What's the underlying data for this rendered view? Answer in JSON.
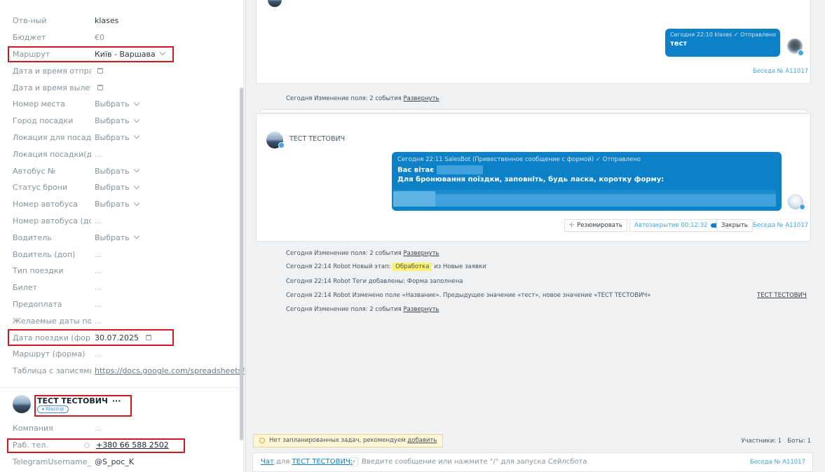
{
  "fields": [
    {
      "label": "Отв-ный",
      "value": "klases",
      "kind": "text"
    },
    {
      "label": "Бюджет",
      "value": "€0",
      "kind": "muted"
    },
    {
      "label": "Маршрут",
      "value": "Київ - Варшава",
      "kind": "select"
    },
    {
      "label": "Дата и время отправл",
      "value": "",
      "kind": "date"
    },
    {
      "label": "Дата и время вылета",
      "value": "",
      "kind": "date"
    },
    {
      "label": "Номер места",
      "value": "Выбрать",
      "kind": "select-muted"
    },
    {
      "label": "Город посадки",
      "value": "Выбрать",
      "kind": "select-muted"
    },
    {
      "label": "Локация для посадки",
      "value": "Выбрать",
      "kind": "select-muted"
    },
    {
      "label": "Локация посадки(доп)",
      "value": "...",
      "kind": "dots"
    },
    {
      "label": "Автобус №",
      "value": "Выбрать",
      "kind": "select-muted"
    },
    {
      "label": "Статус брони",
      "value": "Выбрать",
      "kind": "select-muted"
    },
    {
      "label": "Номер автобуса",
      "value": "Выбрать",
      "kind": "select-muted"
    },
    {
      "label": "Номер автобуса (доп)",
      "value": "...",
      "kind": "dots"
    },
    {
      "label": "Водитель",
      "value": "Выбрать",
      "kind": "select-muted"
    },
    {
      "label": "Водитель (доп)",
      "value": "...",
      "kind": "dots"
    },
    {
      "label": "Тип поездки",
      "value": "...",
      "kind": "dots"
    },
    {
      "label": "Билет",
      "value": "...",
      "kind": "dots"
    },
    {
      "label": "Предоплата",
      "value": "...",
      "kind": "dots"
    },
    {
      "label": "Желаемые даты поезд",
      "value": "...",
      "kind": "dots"
    },
    {
      "label": "Дата поездки (форма)",
      "value": "30.07.2025",
      "kind": "date-filled"
    },
    {
      "label": "Маршрут (форма)",
      "value": "...",
      "kind": "dots"
    },
    {
      "label": "Таблица с записями",
      "value": "https://docs.google.com/spreadsheets/c",
      "kind": "link"
    }
  ],
  "contact": {
    "name": "ТЕСТ ТЕСТОВИЧ",
    "more": "···",
    "source_tag": "◂ Wazzup",
    "company_label": "Компания",
    "company_value": "...",
    "phone_label": "Раб. тел.",
    "phone_value": "+380 66 588 2502",
    "tg_label": "TelegramUsername_W",
    "tg_value": "@S_poc_K"
  },
  "chat": {
    "msg1_meta": "Сегодня 22:10 klases ✓ Отправлено",
    "msg1_text": "тест",
    "convo_label": "Беседа № A11017",
    "event1_prefix": "Сегодня Изменение поля: 2 события",
    "expand_label": "Развернуть",
    "sender_name": "ТЕСТ ТЕСТОВИЧ",
    "msg2_meta": "Сегодня 22:11 SalesBot (Привественное сообщение с формой) ✓ Отправлено",
    "msg2_line1": "Вас вітає",
    "msg2_line2": "Для бронювання поїздки, заповніть, будь ласка, коротку форму:",
    "summarize_label": "Резюмировать",
    "autoclose_label": "Автозакрытие 00:12:32",
    "close_label": "Закрыть",
    "ev_change": "Сегодня Изменение поля: 2 события",
    "ev_stage_prefix": "Сегодня 22:14 Robot Новый этап:",
    "ev_stage_name": "Обработка",
    "ev_stage_suffix": "из Новые заявки",
    "ev_tags": "Сегодня 22:14 Robot Теги добавлены: Форма заполнена",
    "ev_rename": "Сегодня 22:14 Robot Изменено поле «Название». Предыдущее значение «тест», новое значение «ТЕСТ ТЕСТОВИЧ»",
    "ev_rename_link": "ТЕСТ ТЕСТОВИЧ",
    "ev_change2": "Сегодня Изменение поля: 2 события"
  },
  "footer": {
    "task_text": "Нет запланированных задач, рекомендуем",
    "task_link": "добавить",
    "participants": "Участники: 1   Боты: 1",
    "chat_label": "Чат",
    "for_label": "для",
    "recipient": "ТЕСТ ТЕСТОВИЧ:",
    "input_placeholder": "Введите сообщение или нажмите \"/\" для запуска Сейлсбота",
    "convo_label": "Беседа № A11017"
  },
  "colors": {
    "accent": "#0c81c7",
    "highlight_box": "#d0191f",
    "task_bg": "#fdf6d8"
  }
}
